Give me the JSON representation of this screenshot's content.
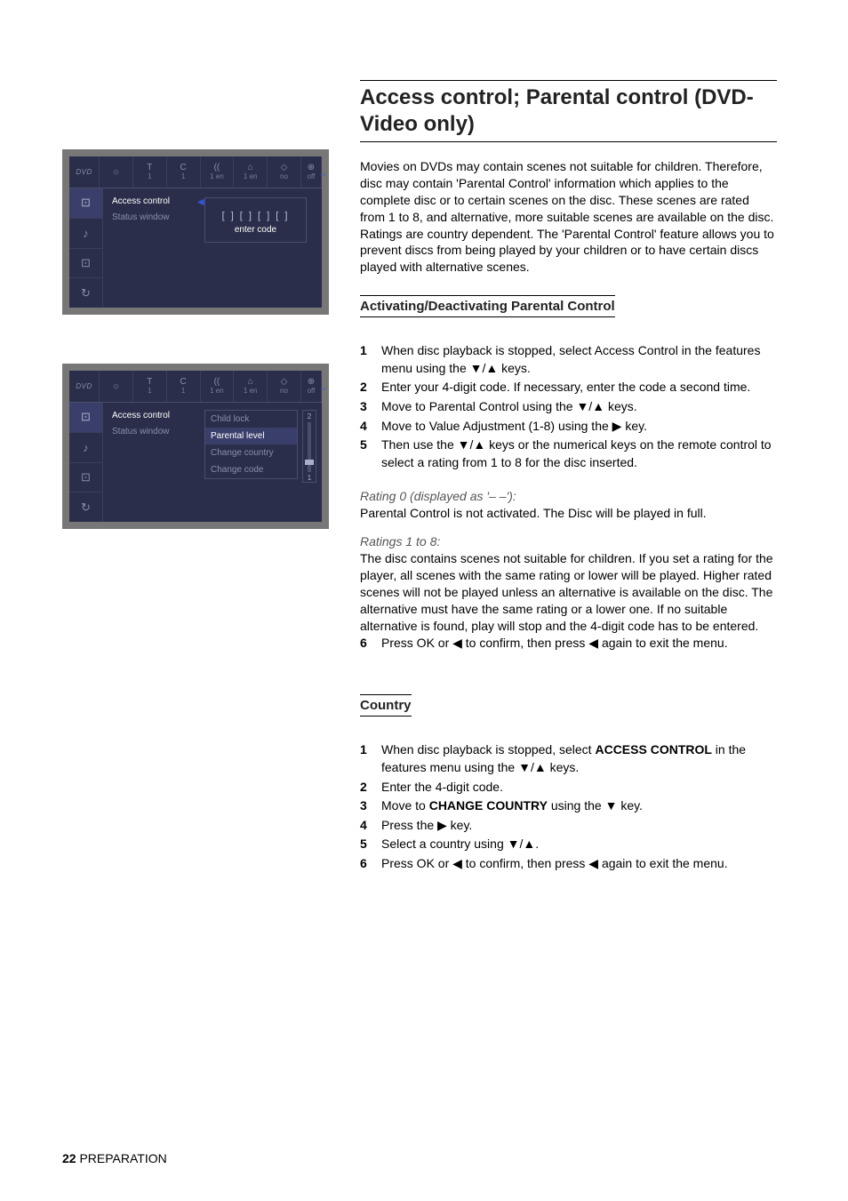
{
  "headings": {
    "main": "Access control; Parental control (DVD-Video only)",
    "sub1": "Activating/Deactivating Parental Control",
    "sub2": "Country"
  },
  "intro": "Movies on DVDs may contain scenes not suitable for children. Therefore, disc may contain 'Parental Control' information which applies to the complete disc or to certain scenes on the disc. These scenes are rated from 1 to 8, and alternative, more suitable scenes are available on the disc. Ratings are country dependent. The 'Parental Control' feature allows you to prevent discs from being played by your children or to have certain discs played with alternative scenes.",
  "activating_steps": [
    {
      "num": "1",
      "text": "When disc playback is stopped, select Access Control in the features menu using the ▼/▲ keys."
    },
    {
      "num": "2",
      "text": "Enter your 4-digit code. If necessary, enter the code a second time."
    },
    {
      "num": "3",
      "text": "Move to Parental Control using the ▼/▲ keys."
    },
    {
      "num": "4",
      "text": "Move to Value Adjustment (1-8) using the ▶ key."
    },
    {
      "num": "5",
      "text": "Then use the ▼/▲ keys or the numerical keys on the remote control to select a rating from 1 to 8 for the disc inserted."
    }
  ],
  "rating0_label": "Rating 0 (displayed as '– –'):",
  "rating0_text": "Parental Control is not activated. The Disc will be played in full.",
  "ratings18_label": "Ratings 1 to 8:",
  "ratings18_text": "The disc contains scenes not suitable for children. If you set a rating for the player, all scenes with the same rating or lower will be played. Higher rated scenes will not be played unless an alternative is available on the disc. The alternative must have the same rating or a lower one. If no suitable alternative is found, play will stop and the 4-digit code has to be entered.",
  "step6": {
    "num": "6",
    "text": "Press OK or ◀ to confirm, then press ◀ again to exit the menu."
  },
  "country_steps": [
    {
      "num": "1",
      "text_pre": "When disc playback is stopped, select ",
      "text_bold": "ACCESS CONTROL",
      "text_post": " in the features menu using the ▼/▲ keys."
    },
    {
      "num": "2",
      "text_pre": "Enter the 4-digit code.",
      "text_bold": "",
      "text_post": ""
    },
    {
      "num": "3",
      "text_pre": "Move to ",
      "text_bold": "CHANGE COUNTRY",
      "text_post": " using the ▼ key."
    },
    {
      "num": "4",
      "text_pre": "Press the ▶ key.",
      "text_bold": "",
      "text_post": ""
    },
    {
      "num": "5",
      "text_pre": "Select a country using ▼/▲.",
      "text_bold": "",
      "text_post": ""
    },
    {
      "num": "6",
      "text_pre": "Press OK or ◀ to confirm, then press ◀ again to exit the menu.",
      "text_bold": "",
      "text_post": ""
    }
  ],
  "osd": {
    "header": [
      "DVD",
      "1",
      "1",
      "1 en",
      "1 en",
      "no",
      "off"
    ],
    "header_icons": [
      "",
      "☼",
      "T",
      "C",
      "((",
      "⌂",
      "◇",
      "⊕"
    ],
    "menu": {
      "access_control": "Access control",
      "status_window": "Status window"
    },
    "code_slots": "[ ] [ ] [ ] [ ]",
    "enter_code": "enter code",
    "submenu": {
      "child_lock": "Child lock",
      "parental_level": "Parental level",
      "change_country": "Change country",
      "change_code": "Change code"
    },
    "slider": {
      "top": "2",
      "bottom": "1"
    }
  },
  "footer": {
    "page": "22",
    "section": "PREPARATION"
  }
}
